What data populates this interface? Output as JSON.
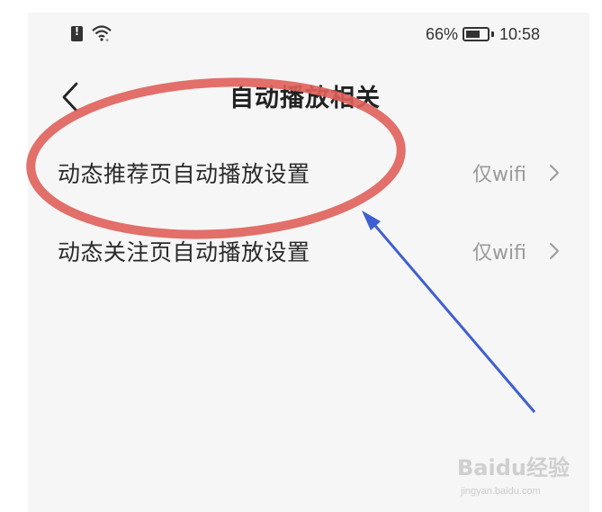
{
  "status_bar": {
    "battery_percent": "66%",
    "time": "10:58",
    "icons": [
      "sim-alert-icon",
      "wifi-icon",
      "battery-icon"
    ]
  },
  "header": {
    "title": "自动播放相关",
    "back_icon": "chevron-left-icon"
  },
  "settings": [
    {
      "label": "动态推荐页自动播放设置",
      "value": "仅wifi",
      "icon": "chevron-right-icon"
    },
    {
      "label": "动态关注页自动播放设置",
      "value": "仅wifi",
      "icon": "chevron-right-icon"
    }
  ],
  "annotation": {
    "ellipse_color": "#e0605a",
    "arrow_color": "#3f5fd0"
  },
  "watermark": {
    "logo_text": "Baidu经验",
    "url": "jingyan.baidu.com"
  }
}
